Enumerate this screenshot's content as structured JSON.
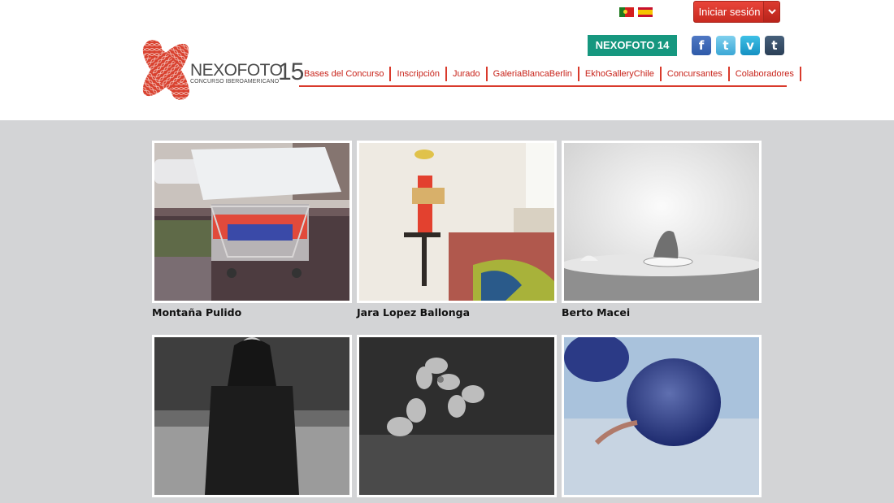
{
  "header": {
    "languages": [
      {
        "name": "Português",
        "icon": "portugal-flag-icon"
      },
      {
        "name": "Español",
        "icon": "spain-flag-icon"
      }
    ],
    "login_label": "Iniciar sesión",
    "previous_edition_label": "NEXOFOTO 14",
    "social": [
      {
        "icon": "facebook-icon",
        "glyph": "f"
      },
      {
        "icon": "twitter-icon",
        "glyph": "t"
      },
      {
        "icon": "vimeo-icon",
        "glyph": "v"
      },
      {
        "icon": "tumblr-icon",
        "glyph": "t"
      }
    ]
  },
  "logo": {
    "word_nexo": "NEXO",
    "word_foto": "FOTO",
    "subtitle": "CONCURSO IBEROAMERICANO",
    "year": "15"
  },
  "nav": {
    "items": [
      "Bases del Concurso",
      "Inscripción",
      "Jurado",
      "GaleriaBlancaBerlin",
      "EkhoGalleryChile",
      "Concursantes",
      "Colaboradores"
    ]
  },
  "gallery": {
    "items": [
      {
        "name": "Montaña Pulido",
        "subject": "shopping cart street photo"
      },
      {
        "name": "Jara Lopez Ballonga",
        "subject": "stacked objects interior"
      },
      {
        "name": "Berto Macei",
        "subject": "fish head on table"
      },
      {
        "name": "",
        "subject": "elderly woman black and white"
      },
      {
        "name": "",
        "subject": "lilac flowers black and white"
      },
      {
        "name": "",
        "subject": "blueberry macro"
      }
    ]
  },
  "colors": {
    "accent_red": "#d93a2c",
    "teal": "#16977f",
    "page_background": "#d3d4d6"
  }
}
